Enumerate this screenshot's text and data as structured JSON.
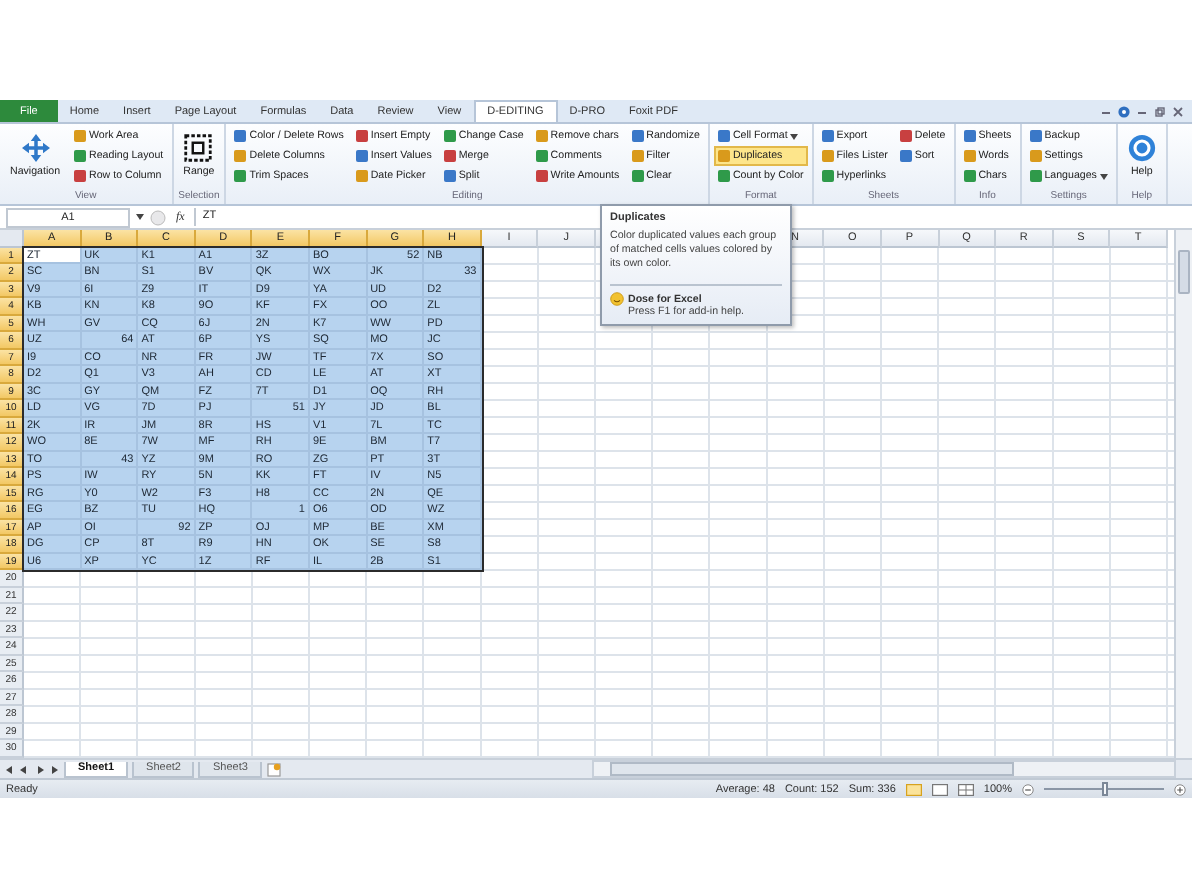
{
  "ribbon_tabs": [
    {
      "label": "File",
      "kind": "file",
      "selected": false
    },
    {
      "label": "Home",
      "kind": "tab",
      "selected": false
    },
    {
      "label": "Insert",
      "kind": "tab",
      "selected": false
    },
    {
      "label": "Page Layout",
      "kind": "tab",
      "selected": false
    },
    {
      "label": "Formulas",
      "kind": "tab",
      "selected": false
    },
    {
      "label": "Data",
      "kind": "tab",
      "selected": false
    },
    {
      "label": "Review",
      "kind": "tab",
      "selected": false
    },
    {
      "label": "View",
      "kind": "tab",
      "selected": false
    },
    {
      "label": "D-EDITING",
      "kind": "tab",
      "selected": true
    },
    {
      "label": "D-PRO",
      "kind": "tab",
      "selected": false
    },
    {
      "label": "Foxit PDF",
      "kind": "tab",
      "selected": false
    }
  ],
  "ribbon_groups": [
    {
      "label": "View",
      "items": [
        {
          "label": "Navigation",
          "kind": "large",
          "selected": false
        },
        {
          "label": "Work Area",
          "kind": "small",
          "selected": false
        },
        {
          "label": "Reading Layout",
          "kind": "small",
          "selected": false
        },
        {
          "label": "Row to Column",
          "kind": "small",
          "selected": false
        }
      ]
    },
    {
      "label": "Selection",
      "items": [
        {
          "label": "Range",
          "kind": "large",
          "selected": false
        }
      ]
    },
    {
      "label": "Editing",
      "items": [
        {
          "label": "Color / Delete Rows",
          "kind": "small",
          "selected": false
        },
        {
          "label": "Delete Columns",
          "kind": "small",
          "selected": false
        },
        {
          "label": "Trim Spaces",
          "kind": "small",
          "selected": false
        },
        {
          "label": "Insert Empty",
          "kind": "small",
          "selected": false
        },
        {
          "label": "Insert Values",
          "kind": "small",
          "selected": false
        },
        {
          "label": "Date Picker",
          "kind": "small",
          "selected": false
        },
        {
          "label": "Change Case",
          "kind": "small",
          "selected": false
        },
        {
          "label": "Merge",
          "kind": "small",
          "selected": false
        },
        {
          "label": "Split",
          "kind": "small",
          "selected": false
        },
        {
          "label": "Remove chars",
          "kind": "small",
          "selected": false
        },
        {
          "label": "Comments",
          "kind": "small",
          "selected": false
        },
        {
          "label": "Write Amounts",
          "kind": "small",
          "selected": false
        },
        {
          "label": "Randomize",
          "kind": "small",
          "selected": false
        },
        {
          "label": "Filter",
          "kind": "small",
          "selected": false
        },
        {
          "label": "Clear",
          "kind": "small",
          "selected": false
        }
      ]
    },
    {
      "label": "Format",
      "items": [
        {
          "label": "Cell Format",
          "kind": "menu",
          "selected": false
        },
        {
          "label": "Duplicates",
          "kind": "small",
          "selected": true
        },
        {
          "label": "Count by Color",
          "kind": "small",
          "selected": false
        }
      ]
    },
    {
      "label": "Sheets",
      "items": [
        {
          "label": "Export",
          "kind": "small",
          "selected": false
        },
        {
          "label": "Files Lister",
          "kind": "small",
          "selected": false
        },
        {
          "label": "Hyperlinks",
          "kind": "small",
          "selected": false
        },
        {
          "label": "Delete",
          "kind": "small",
          "selected": false
        },
        {
          "label": "Sort",
          "kind": "small",
          "selected": false
        }
      ]
    },
    {
      "label": "Info",
      "items": [
        {
          "label": "Sheets",
          "kind": "small",
          "selected": false
        },
        {
          "label": "Words",
          "kind": "small",
          "selected": false
        },
        {
          "label": "Chars",
          "kind": "small",
          "selected": false
        }
      ]
    },
    {
      "label": "Settings",
      "items": [
        {
          "label": "Backup",
          "kind": "small",
          "selected": false
        },
        {
          "label": "Settings",
          "kind": "small",
          "selected": false
        },
        {
          "label": "Languages",
          "kind": "menu",
          "selected": false
        }
      ]
    },
    {
      "label": "Help",
      "items": [
        {
          "label": "Help",
          "kind": "large",
          "selected": false
        }
      ]
    }
  ],
  "formula_bar": {
    "name_box": "A1",
    "function_label": "fx",
    "formula": "ZT"
  },
  "columns": [
    {
      "label": "A",
      "selected": true
    },
    {
      "label": "B",
      "selected": true
    },
    {
      "label": "C",
      "selected": true
    },
    {
      "label": "D",
      "selected": true
    },
    {
      "label": "E",
      "selected": true
    },
    {
      "label": "F",
      "selected": true
    },
    {
      "label": "G",
      "selected": true
    },
    {
      "label": "H",
      "selected": true
    },
    {
      "label": "I",
      "selected": false
    },
    {
      "label": "J",
      "selected": false
    },
    {
      "label": "N",
      "selected": false
    },
    {
      "label": "O",
      "selected": false
    },
    {
      "label": "P",
      "selected": false
    },
    {
      "label": "Q",
      "selected": false
    },
    {
      "label": "R",
      "selected": false
    },
    {
      "label": "S",
      "selected": false
    },
    {
      "label": "T",
      "selected": false
    }
  ],
  "row_headers": [
    {
      "label": "1",
      "selected": true
    },
    {
      "label": "2",
      "selected": true
    },
    {
      "label": "3",
      "selected": true
    },
    {
      "label": "4",
      "selected": true
    },
    {
      "label": "5",
      "selected": true
    },
    {
      "label": "6",
      "selected": true
    },
    {
      "label": "7",
      "selected": true
    },
    {
      "label": "8",
      "selected": true
    },
    {
      "label": "9",
      "selected": true
    },
    {
      "label": "10",
      "selected": true
    },
    {
      "label": "11",
      "selected": true
    },
    {
      "label": "12",
      "selected": true
    },
    {
      "label": "13",
      "selected": true
    },
    {
      "label": "14",
      "selected": true
    },
    {
      "label": "15",
      "selected": true
    },
    {
      "label": "16",
      "selected": true
    },
    {
      "label": "17",
      "selected": true
    },
    {
      "label": "18",
      "selected": true
    },
    {
      "label": "19",
      "selected": true
    },
    {
      "label": "20",
      "selected": false
    },
    {
      "label": "21",
      "selected": false
    },
    {
      "label": "22",
      "selected": false
    },
    {
      "label": "23",
      "selected": false
    },
    {
      "label": "24",
      "selected": false
    },
    {
      "label": "25",
      "selected": false
    },
    {
      "label": "26",
      "selected": false
    },
    {
      "label": "27",
      "selected": false
    },
    {
      "label": "28",
      "selected": false
    },
    {
      "label": "29",
      "selected": false
    },
    {
      "label": "30",
      "selected": false
    }
  ],
  "rows": [
    [
      {
        "text": "ZT",
        "kind": "text"
      },
      {
        "text": "UK",
        "kind": "text"
      },
      {
        "text": "K1",
        "kind": "text"
      },
      {
        "text": "A1",
        "kind": "text"
      },
      {
        "text": "3Z",
        "kind": "text"
      },
      {
        "text": "BO",
        "kind": "text"
      },
      {
        "text": "52",
        "kind": "number"
      },
      {
        "text": "NB",
        "kind": "text"
      }
    ],
    [
      {
        "text": "SC",
        "kind": "text"
      },
      {
        "text": "BN",
        "kind": "text"
      },
      {
        "text": "S1",
        "kind": "text"
      },
      {
        "text": "BV",
        "kind": "text"
      },
      {
        "text": "QK",
        "kind": "text"
      },
      {
        "text": "WX",
        "kind": "text"
      },
      {
        "text": "JK",
        "kind": "text"
      },
      {
        "text": "33",
        "kind": "number"
      }
    ],
    [
      {
        "text": "V9",
        "kind": "text"
      },
      {
        "text": "6I",
        "kind": "text"
      },
      {
        "text": "Z9",
        "kind": "text"
      },
      {
        "text": "IT",
        "kind": "text"
      },
      {
        "text": "D9",
        "kind": "text"
      },
      {
        "text": "YA",
        "kind": "text"
      },
      {
        "text": "UD",
        "kind": "text"
      },
      {
        "text": "D2",
        "kind": "text"
      }
    ],
    [
      {
        "text": "KB",
        "kind": "text"
      },
      {
        "text": "KN",
        "kind": "text"
      },
      {
        "text": "K8",
        "kind": "text"
      },
      {
        "text": "9O",
        "kind": "text"
      },
      {
        "text": "KF",
        "kind": "text"
      },
      {
        "text": "FX",
        "kind": "text"
      },
      {
        "text": "OO",
        "kind": "text"
      },
      {
        "text": "ZL",
        "kind": "text"
      }
    ],
    [
      {
        "text": "WH",
        "kind": "text"
      },
      {
        "text": "GV",
        "kind": "text"
      },
      {
        "text": "CQ",
        "kind": "text"
      },
      {
        "text": "6J",
        "kind": "text"
      },
      {
        "text": "2N",
        "kind": "text"
      },
      {
        "text": "K7",
        "kind": "text"
      },
      {
        "text": "WW",
        "kind": "text"
      },
      {
        "text": "PD",
        "kind": "text"
      }
    ],
    [
      {
        "text": "UZ",
        "kind": "text"
      },
      {
        "text": "64",
        "kind": "number"
      },
      {
        "text": "AT",
        "kind": "text"
      },
      {
        "text": "6P",
        "kind": "text"
      },
      {
        "text": "YS",
        "kind": "text"
      },
      {
        "text": "SQ",
        "kind": "text"
      },
      {
        "text": "MO",
        "kind": "text"
      },
      {
        "text": "JC",
        "kind": "text"
      }
    ],
    [
      {
        "text": "I9",
        "kind": "text"
      },
      {
        "text": "CO",
        "kind": "text"
      },
      {
        "text": "NR",
        "kind": "text"
      },
      {
        "text": "FR",
        "kind": "text"
      },
      {
        "text": "JW",
        "kind": "text"
      },
      {
        "text": "TF",
        "kind": "text"
      },
      {
        "text": "7X",
        "kind": "text"
      },
      {
        "text": "SO",
        "kind": "text"
      }
    ],
    [
      {
        "text": "D2",
        "kind": "text"
      },
      {
        "text": "Q1",
        "kind": "text"
      },
      {
        "text": "V3",
        "kind": "text"
      },
      {
        "text": "AH",
        "kind": "text"
      },
      {
        "text": "CD",
        "kind": "text"
      },
      {
        "text": "LE",
        "kind": "text"
      },
      {
        "text": "AT",
        "kind": "text"
      },
      {
        "text": "XT",
        "kind": "text"
      }
    ],
    [
      {
        "text": "3C",
        "kind": "text"
      },
      {
        "text": "GY",
        "kind": "text"
      },
      {
        "text": "QM",
        "kind": "text"
      },
      {
        "text": "FZ",
        "kind": "text"
      },
      {
        "text": "7T",
        "kind": "text"
      },
      {
        "text": "D1",
        "kind": "text"
      },
      {
        "text": "OQ",
        "kind": "text"
      },
      {
        "text": "RH",
        "kind": "text"
      }
    ],
    [
      {
        "text": "LD",
        "kind": "text"
      },
      {
        "text": "VG",
        "kind": "text"
      },
      {
        "text": "7D",
        "kind": "text"
      },
      {
        "text": "PJ",
        "kind": "text"
      },
      {
        "text": "51",
        "kind": "number"
      },
      {
        "text": "JY",
        "kind": "text"
      },
      {
        "text": "JD",
        "kind": "text"
      },
      {
        "text": "BL",
        "kind": "text"
      }
    ],
    [
      {
        "text": "2K",
        "kind": "text"
      },
      {
        "text": "IR",
        "kind": "text"
      },
      {
        "text": "JM",
        "kind": "text"
      },
      {
        "text": "8R",
        "kind": "text"
      },
      {
        "text": "HS",
        "kind": "text"
      },
      {
        "text": "V1",
        "kind": "text"
      },
      {
        "text": "7L",
        "kind": "text"
      },
      {
        "text": "TC",
        "kind": "text"
      }
    ],
    [
      {
        "text": "WO",
        "kind": "text"
      },
      {
        "text": "8E",
        "kind": "text"
      },
      {
        "text": "7W",
        "kind": "text"
      },
      {
        "text": "MF",
        "kind": "text"
      },
      {
        "text": "RH",
        "kind": "text"
      },
      {
        "text": "9E",
        "kind": "text"
      },
      {
        "text": "BM",
        "kind": "text"
      },
      {
        "text": "T7",
        "kind": "text"
      }
    ],
    [
      {
        "text": "TO",
        "kind": "text"
      },
      {
        "text": "43",
        "kind": "number"
      },
      {
        "text": "YZ",
        "kind": "text"
      },
      {
        "text": "9M",
        "kind": "text"
      },
      {
        "text": "RO",
        "kind": "text"
      },
      {
        "text": "ZG",
        "kind": "text"
      },
      {
        "text": "PT",
        "kind": "text"
      },
      {
        "text": "3T",
        "kind": "text"
      }
    ],
    [
      {
        "text": "PS",
        "kind": "text"
      },
      {
        "text": "IW",
        "kind": "text"
      },
      {
        "text": "RY",
        "kind": "text"
      },
      {
        "text": "5N",
        "kind": "text"
      },
      {
        "text": "KK",
        "kind": "text"
      },
      {
        "text": "FT",
        "kind": "text"
      },
      {
        "text": "IV",
        "kind": "text"
      },
      {
        "text": "N5",
        "kind": "text"
      }
    ],
    [
      {
        "text": "RG",
        "kind": "text"
      },
      {
        "text": "Y0",
        "kind": "text"
      },
      {
        "text": "W2",
        "kind": "text"
      },
      {
        "text": "F3",
        "kind": "text"
      },
      {
        "text": "H8",
        "kind": "text"
      },
      {
        "text": "CC",
        "kind": "text"
      },
      {
        "text": "2N",
        "kind": "text"
      },
      {
        "text": "QE",
        "kind": "text"
      }
    ],
    [
      {
        "text": "EG",
        "kind": "text"
      },
      {
        "text": "BZ",
        "kind": "text"
      },
      {
        "text": "TU",
        "kind": "text"
      },
      {
        "text": "HQ",
        "kind": "text"
      },
      {
        "text": "1",
        "kind": "number"
      },
      {
        "text": "O6",
        "kind": "text"
      },
      {
        "text": "OD",
        "kind": "text"
      },
      {
        "text": "WZ",
        "kind": "text"
      }
    ],
    [
      {
        "text": "AP",
        "kind": "text"
      },
      {
        "text": "OI",
        "kind": "text"
      },
      {
        "text": "92",
        "kind": "number"
      },
      {
        "text": "ZP",
        "kind": "text"
      },
      {
        "text": "OJ",
        "kind": "text"
      },
      {
        "text": "MP",
        "kind": "text"
      },
      {
        "text": "BE",
        "kind": "text"
      },
      {
        "text": "XM",
        "kind": "text"
      }
    ],
    [
      {
        "text": "DG",
        "kind": "text"
      },
      {
        "text": "CP",
        "kind": "text"
      },
      {
        "text": "8T",
        "kind": "text"
      },
      {
        "text": "R9",
        "kind": "text"
      },
      {
        "text": "HN",
        "kind": "text"
      },
      {
        "text": "OK",
        "kind": "text"
      },
      {
        "text": "SE",
        "kind": "text"
      },
      {
        "text": "S8",
        "kind": "text"
      }
    ],
    [
      {
        "text": "U6",
        "kind": "text"
      },
      {
        "text": "XP",
        "kind": "text"
      },
      {
        "text": "YC",
        "kind": "text"
      },
      {
        "text": "1Z",
        "kind": "text"
      },
      {
        "text": "RF",
        "kind": "text"
      },
      {
        "text": "IL",
        "kind": "text"
      },
      {
        "text": "2B",
        "kind": "text"
      },
      {
        "text": "S1",
        "kind": "text"
      }
    ]
  ],
  "tooltip": {
    "title": "Duplicates",
    "description": "Color duplicated values each group of matched cells values colored by its own color.",
    "addin": "Dose for Excel",
    "hint": "Press F1 for add-in help."
  },
  "sheet_tabs": [
    {
      "label": "Sheet1",
      "selected": true
    },
    {
      "label": "Sheet2",
      "selected": false
    },
    {
      "label": "Sheet3",
      "selected": false
    }
  ],
  "status_bar": {
    "mode": "Ready",
    "average": "Average: 48",
    "count": "Count: 152",
    "sum": "Sum: 336",
    "zoom": "100%",
    "zoom_slider": {
      "level": 0.5
    }
  }
}
